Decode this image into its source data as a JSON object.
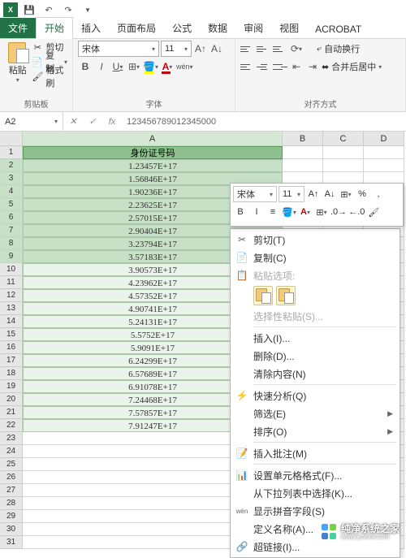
{
  "qat": {
    "app": "X"
  },
  "tabs": {
    "file": "文件",
    "home": "开始",
    "insert": "插入",
    "layout": "页面布局",
    "formulas": "公式",
    "data": "数据",
    "review": "审阅",
    "view": "视图",
    "acrobat": "ACROBAT"
  },
  "ribbon": {
    "paste": "粘贴",
    "cut": "剪切",
    "copy": "复制",
    "format_painter": "格式刷",
    "clipboard": "剪贴板",
    "font_name": "宋体",
    "font_size": "11",
    "font": "字体",
    "wrap": "自动换行",
    "merge": "合并后居中",
    "align": "对齐方式"
  },
  "name_box": "A2",
  "formula": "123456789012345000",
  "columns": [
    "A",
    "B",
    "C",
    "D"
  ],
  "header_cell": "身份证号码",
  "data_rows": [
    "1.23457E+17",
    "1.56846E+17",
    "1.90236E+17",
    "2.23625E+17",
    "2.57015E+17",
    "2.90404E+17",
    "3.23794E+17",
    "3.57183E+17",
    "3.90573E+17",
    "4.23962E+17",
    "4.57352E+17",
    "4.90741E+17",
    "5.24131E+17",
    "5.5752E+17",
    "5.9091E+17",
    "6.24299E+17",
    "6.57689E+17",
    "6.91078E+17",
    "7.24468E+17",
    "7.57857E+17",
    "7.91247E+17"
  ],
  "mini": {
    "font": "宋体",
    "size": "11"
  },
  "ctx": {
    "cut": "剪切(T)",
    "copy": "复制(C)",
    "paste_opts": "粘贴选项:",
    "paste_special": "选择性粘贴(S)...",
    "insert": "插入(I)...",
    "delete": "删除(D)...",
    "clear": "清除内容(N)",
    "quick_analysis": "快速分析(Q)",
    "filter": "筛选(E)",
    "sort": "排序(O)",
    "insert_comment": "插入批注(M)",
    "format_cells": "设置单元格格式(F)...",
    "pick_list": "从下拉列表中选择(K)...",
    "show_pinyin": "显示拼音字段(S)",
    "define_name": "定义名称(A)...",
    "hyperlink": "超链接(I)..."
  },
  "watermark": {
    "cn": "纯净系统之家",
    "url": "www.ycwxw.com"
  }
}
